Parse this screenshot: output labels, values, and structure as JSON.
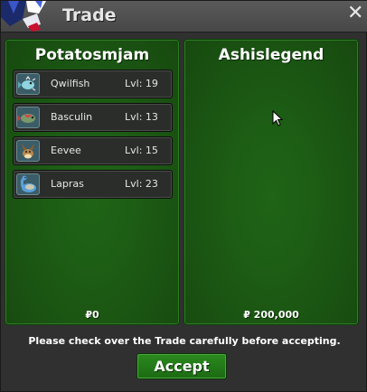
{
  "window": {
    "title": "Trade",
    "close_icon": "close-icon"
  },
  "left_panel": {
    "player_name": "Potatosmjam",
    "pokemon": [
      {
        "name": "Qwilfish",
        "level": "Lvl: 19",
        "icon": "qwilfish-icon"
      },
      {
        "name": "Basculin",
        "level": "Lvl: 13",
        "icon": "basculin-icon"
      },
      {
        "name": "Eevee",
        "level": "Lvl: 15",
        "icon": "eevee-icon"
      },
      {
        "name": "Lapras",
        "level": "Lvl: 23",
        "icon": "lapras-icon"
      }
    ],
    "money": "₽0"
  },
  "right_panel": {
    "player_name": "Ashislegend",
    "pokemon": [],
    "money": "₽ 200,000"
  },
  "footer": {
    "notice": "Please check over the Trade carefully before accepting.",
    "accept_label": "Accept"
  },
  "colors": {
    "panel_green": "#1d5d15",
    "button_green": "#2b8a1e",
    "titlebar": "#4f4f4f"
  }
}
